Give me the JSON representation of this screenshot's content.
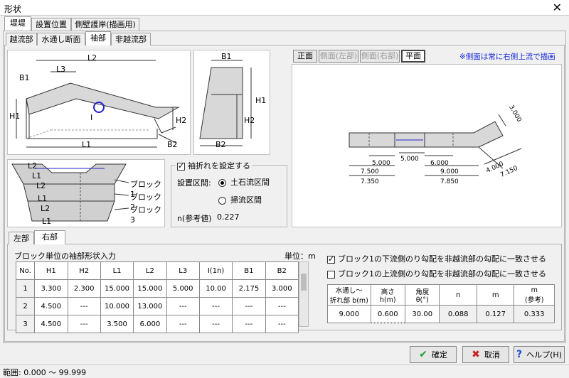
{
  "window": {
    "title": "形状",
    "close_glyph": "✕"
  },
  "top_tabs": [
    "堤堤",
    "設置位置",
    "側壁護岸(描画用)"
  ],
  "sub_tabs": [
    "越流部",
    "水通し断面",
    "袖部",
    "非越流部"
  ],
  "diagram1": {
    "labels": {
      "L2": "L2",
      "L3": "L3",
      "B1": "B1",
      "H1": "H1",
      "I": "I",
      "H2": "H2",
      "L1": "L1",
      "B2": "B2"
    }
  },
  "diagram2": {
    "labels": {
      "B1": "B1",
      "H1": "H1",
      "H2": "H2",
      "B2": "B2"
    }
  },
  "block_diagram": {
    "left_labels": [
      "L2",
      "L1",
      "L2",
      "L1",
      "L2",
      "L1"
    ],
    "right_labels": [
      "ブロック1",
      "ブロック2",
      "ブロック3"
    ]
  },
  "settings": {
    "fold_checkbox_label": "袖折れを設定する",
    "interval_label": "設置区間:",
    "radio1": "土石流区間",
    "radio2": "掃流区間",
    "n_label": "n(参考値)",
    "n_value": "0.227"
  },
  "view_buttons": [
    "正面",
    "側面(左部)",
    "側面(右部)",
    "平面"
  ],
  "view_note": "※側面は常に右側上流で描画",
  "plan_dims": {
    "d1": "5.000",
    "d2": "5.000",
    "d3": "6.000",
    "d4": "7.500",
    "d5": "9.000",
    "d6": "7.350",
    "d7": "7.850",
    "d8": "4.000",
    "d9": "7.150",
    "d10": "3.000"
  },
  "side_tabs": [
    "左部",
    "右部"
  ],
  "block_input": {
    "title": "ブロック単位の袖部形状入力",
    "unit": "単位：m",
    "headers": [
      "No.",
      "H1",
      "H2",
      "L1",
      "L2",
      "L3",
      "I(1n)",
      "B1",
      "B2"
    ],
    "rows": [
      [
        "1",
        "3.300",
        "2.300",
        "15.000",
        "15.000",
        "5.000",
        "10.00",
        "2.175",
        "3.000"
      ],
      [
        "2",
        "4.500",
        "---",
        "10.000",
        "13.000",
        "---",
        "---",
        "---",
        "---"
      ],
      [
        "3",
        "4.500",
        "---",
        "3.500",
        "6.000",
        "---",
        "---",
        "---",
        "---"
      ]
    ]
  },
  "options": {
    "check1": "ブロック1の下流側のり勾配を非越流部の勾配に一致させる",
    "check2": "ブロック1の上流側のり勾配を非越流部の勾配に一致させる"
  },
  "mizutoshi": {
    "headers": [
      "水通し～\n折れ部 b(m)",
      "高さ\nh(m)",
      "角度\nθ(°)",
      "n",
      "m",
      "m\n(参考)"
    ],
    "values": [
      "9.000",
      "0.600",
      "30.00",
      "0.088",
      "0.127",
      "0.333"
    ]
  },
  "buttons": {
    "ok": "確定",
    "cancel": "取消",
    "help": "ヘルプ(H)"
  },
  "status": "範囲: 0.000 ～ 99.999"
}
